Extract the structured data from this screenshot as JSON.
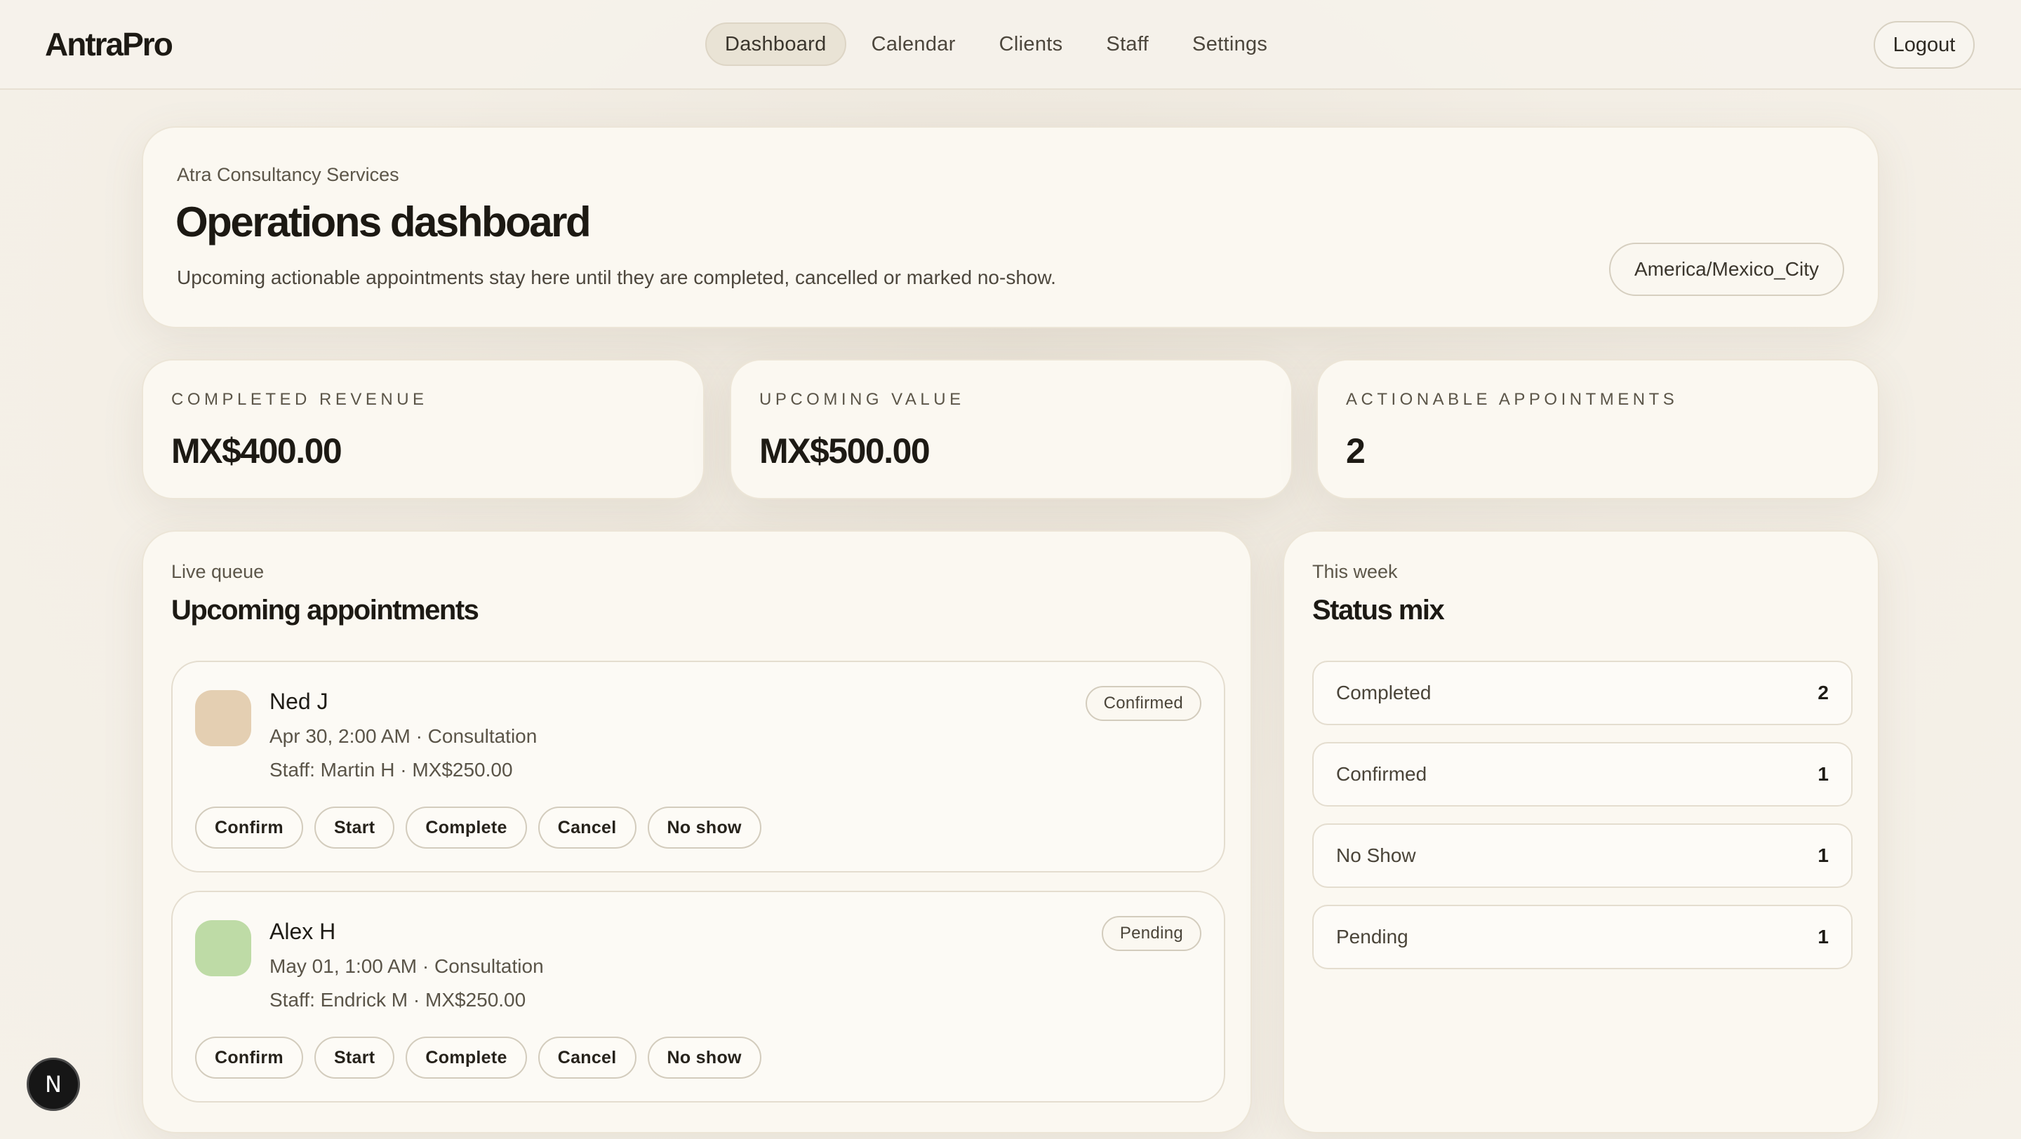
{
  "app": {
    "name": "AntraPro"
  },
  "nav": {
    "items": [
      {
        "label": "Dashboard",
        "active": true
      },
      {
        "label": "Calendar",
        "active": false
      },
      {
        "label": "Clients",
        "active": false
      },
      {
        "label": "Staff",
        "active": false
      },
      {
        "label": "Settings",
        "active": false
      }
    ],
    "logout_label": "Logout"
  },
  "hero": {
    "org": "Atra Consultancy Services",
    "title": "Operations dashboard",
    "description": "Upcoming actionable appointments stay here until they are completed, cancelled or marked no-show.",
    "timezone": "America/Mexico_City"
  },
  "stats": [
    {
      "label": "COMPLETED REVENUE",
      "value": "MX$400.00"
    },
    {
      "label": "UPCOMING VALUE",
      "value": "MX$500.00"
    },
    {
      "label": "ACTIONABLE APPOINTMENTS",
      "value": "2"
    }
  ],
  "queue": {
    "eyebrow": "Live queue",
    "title": "Upcoming appointments",
    "appointments": [
      {
        "name": "Ned J",
        "when_service": "Apr 30, 2:00 AM · Consultation",
        "staff_price": "Staff: Martin H · MX$250.00",
        "status": "Confirmed",
        "avatar_color": "#e4cfb2"
      },
      {
        "name": "Alex H",
        "when_service": "May 01, 1:00 AM · Consultation",
        "staff_price": "Staff: Endrick M · MX$250.00",
        "status": "Pending",
        "avatar_color": "#bedba6"
      }
    ],
    "actions": [
      "Confirm",
      "Start",
      "Complete",
      "Cancel",
      "No show"
    ]
  },
  "status_mix": {
    "eyebrow": "This week",
    "title": "Status mix",
    "rows": [
      {
        "label": "Completed",
        "count": "2"
      },
      {
        "label": "Confirmed",
        "count": "1"
      },
      {
        "label": "No Show",
        "count": "1"
      },
      {
        "label": "Pending",
        "count": "1"
      }
    ]
  },
  "dev_badge": {
    "letter": "N"
  },
  "icons": {
    "dev_badge": "nextjs-n-icon"
  },
  "colors": {
    "background": "#f4efe6",
    "card": "#fbf8f1",
    "text": "#1d1a14"
  }
}
